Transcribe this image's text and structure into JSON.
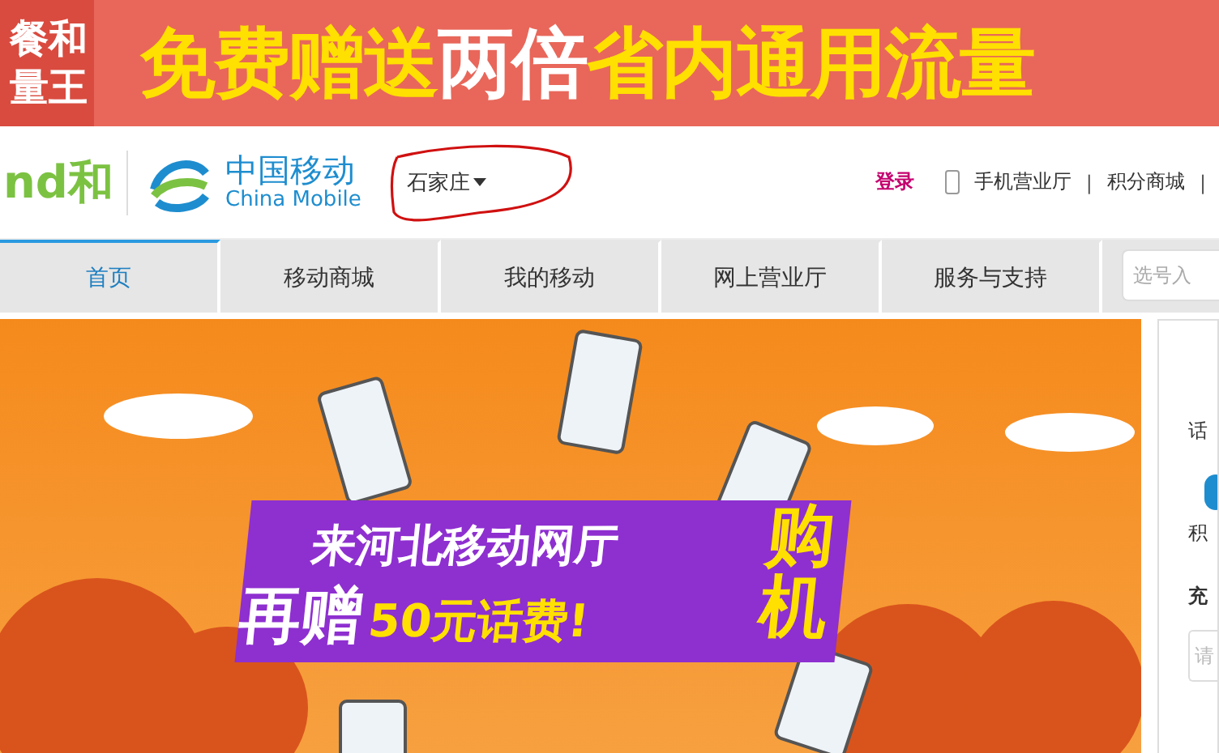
{
  "top_banner": {
    "side_text": [
      "餐和",
      "量王"
    ],
    "headline": [
      {
        "text": "免费赠送",
        "highlight": false
      },
      {
        "text": "两倍",
        "highlight": true
      },
      {
        "text": "省内通用流量",
        "highlight": false
      }
    ]
  },
  "header": {
    "brand_logo_text": "nd和",
    "logo_cn": "中国移动",
    "logo_en": "China Mobile",
    "city": "石家庄",
    "links": [
      {
        "text": "登录",
        "kind": "login"
      },
      {
        "text": "手机营业厅",
        "kind": "phone"
      },
      {
        "text": "|",
        "kind": "separator"
      },
      {
        "text": "积分商城",
        "kind": "plain"
      },
      {
        "text": "|",
        "kind": "separator"
      }
    ]
  },
  "nav": {
    "tabs": [
      {
        "label": "首页",
        "selected": true
      },
      {
        "label": "移动商城",
        "selected": false
      },
      {
        "label": "我的移动",
        "selected": false
      },
      {
        "label": "网上营业厅",
        "selected": false
      },
      {
        "label": "服务与支持",
        "selected": false
      }
    ],
    "search": {
      "placeholder": "选号入"
    }
  },
  "hero": {
    "line1": "来河北移动网厅",
    "line2a": "再赠",
    "line2b": "50元话费!",
    "side": [
      "购",
      "机"
    ]
  },
  "side_panel": {
    "texts": [
      "话",
      "积",
      "充"
    ],
    "input": {
      "placeholder": "请"
    }
  }
}
